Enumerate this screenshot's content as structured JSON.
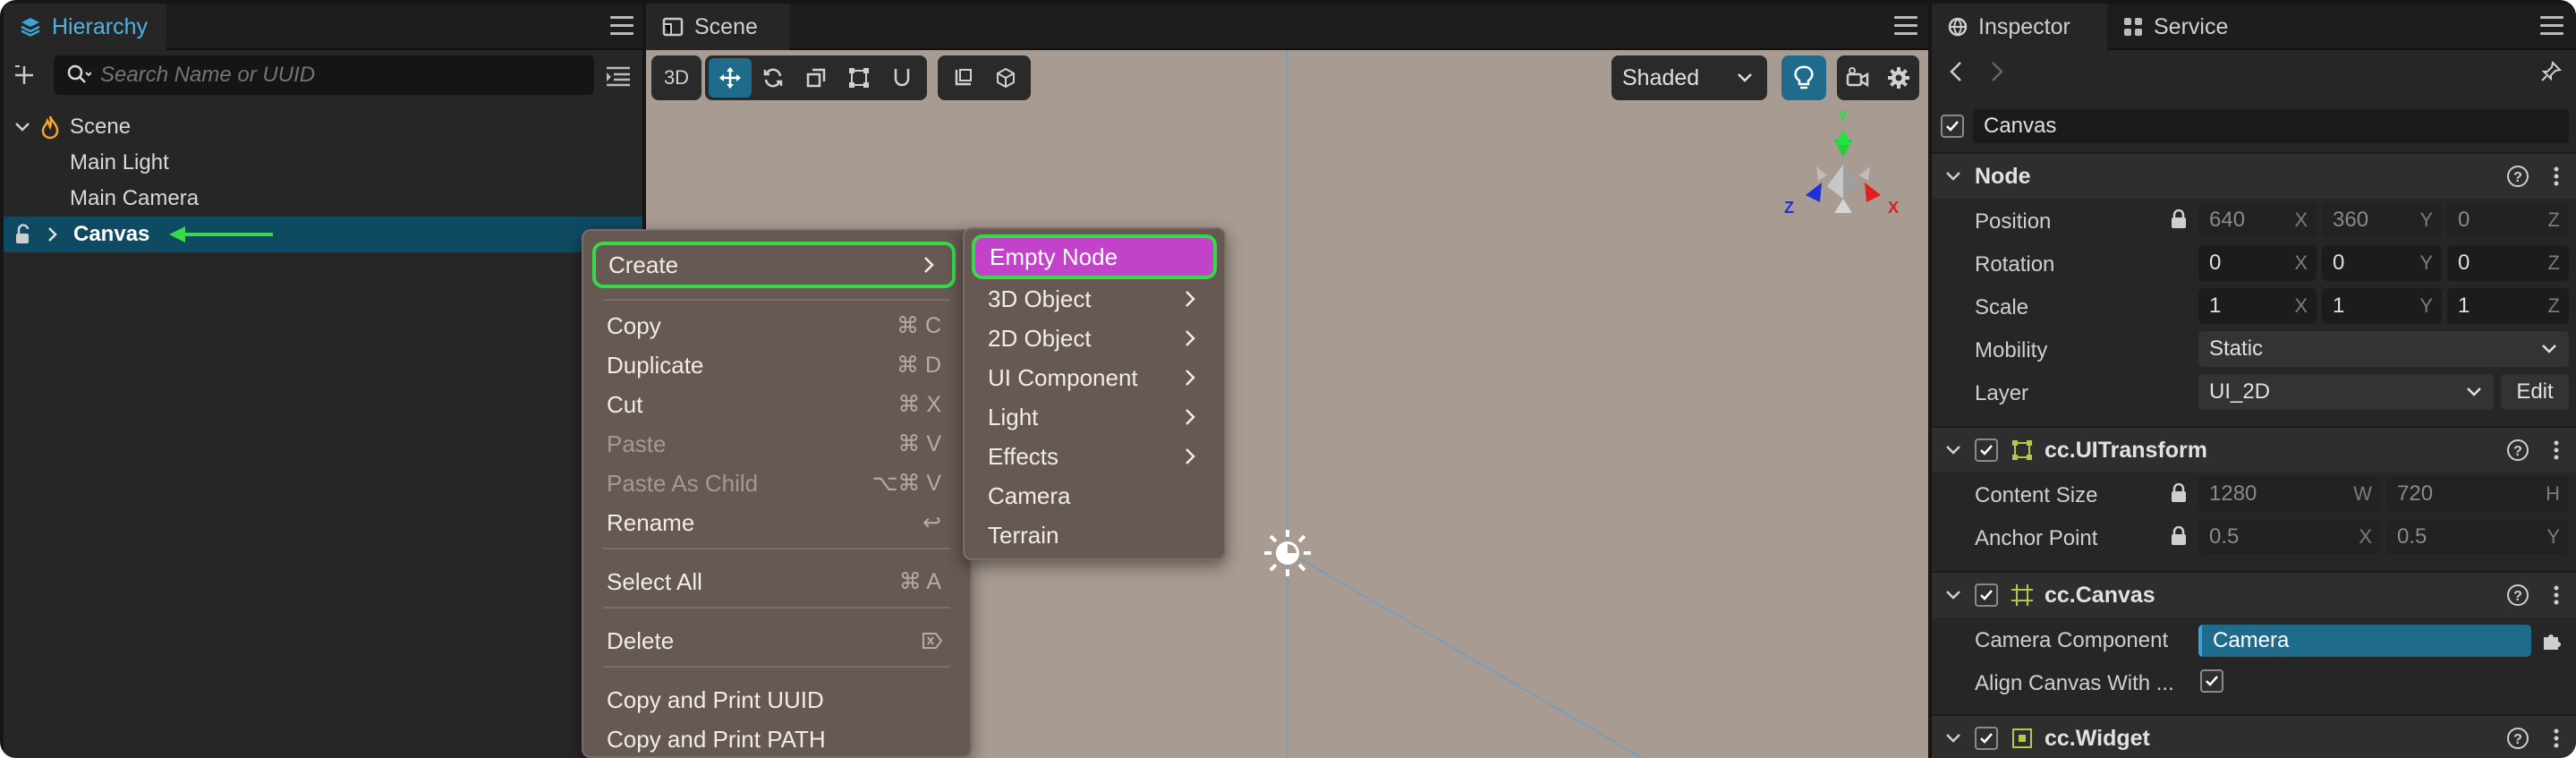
{
  "hierarchy": {
    "tab_label": "Hierarchy",
    "search_placeholder": "Search Name or UUID",
    "nodes": [
      "Scene",
      "Main Light",
      "Main Camera",
      "Canvas"
    ]
  },
  "scene": {
    "tab_label": "Scene",
    "mode_button": "3D",
    "shading": "Shaded",
    "gizmo_axes": [
      "Y",
      "Z",
      "X"
    ]
  },
  "context_menu": {
    "items": [
      {
        "label": "Create",
        "shortcut": ""
      },
      {
        "label": "Copy",
        "shortcut": "⌘ C"
      },
      {
        "label": "Duplicate",
        "shortcut": "⌘ D"
      },
      {
        "label": "Cut",
        "shortcut": "⌘ X"
      },
      {
        "label": "Paste",
        "shortcut": "⌘ V"
      },
      {
        "label": "Paste As Child",
        "shortcut": "⌥⌘ V"
      },
      {
        "label": "Rename",
        "shortcut": "↩"
      },
      {
        "label": "Select All",
        "shortcut": "⌘ A"
      },
      {
        "label": "Delete",
        "shortcut": ""
      },
      {
        "label": "Copy and Print UUID",
        "shortcut": ""
      },
      {
        "label": "Copy and Print PATH",
        "shortcut": ""
      }
    ]
  },
  "create_submenu": {
    "items": [
      "Empty Node",
      "3D Object",
      "2D Object",
      "UI Component",
      "Light",
      "Effects",
      "Camera",
      "Terrain"
    ]
  },
  "inspector": {
    "tab_label": "Inspector",
    "service_tab_label": "Service",
    "node_name": "Canvas",
    "node_section": {
      "title": "Node",
      "position_label": "Position",
      "position": [
        "640",
        "360",
        "0"
      ],
      "rotation_label": "Rotation",
      "rotation": [
        "0",
        "0",
        "0"
      ],
      "scale_label": "Scale",
      "scale": [
        "1",
        "1",
        "1"
      ],
      "axis_labels": [
        "X",
        "Y",
        "Z"
      ],
      "mobility_label": "Mobility",
      "mobility": "Static",
      "layer_label": "Layer",
      "layer": "UI_2D",
      "edit_button": "Edit"
    },
    "uitransform": {
      "title": "cc.UITransform",
      "content_size_label": "Content Size",
      "width": "1280",
      "height": "720",
      "wh_labels": [
        "W",
        "H"
      ],
      "anchor_label": "Anchor Point",
      "anchor": [
        "0.5",
        "0.5"
      ]
    },
    "canvas": {
      "title": "cc.Canvas",
      "camera_component_label": "Camera Component",
      "camera_component": "Camera",
      "align_label": "Align Canvas With ..."
    },
    "widget": {
      "title": "cc.Widget"
    }
  },
  "colors": {
    "accent": "#1f6b8c",
    "selection": "#0f4a63",
    "highlight_green": "#39d84b",
    "highlight_magenta": "#c243c9",
    "menu_bg": "#665852"
  }
}
